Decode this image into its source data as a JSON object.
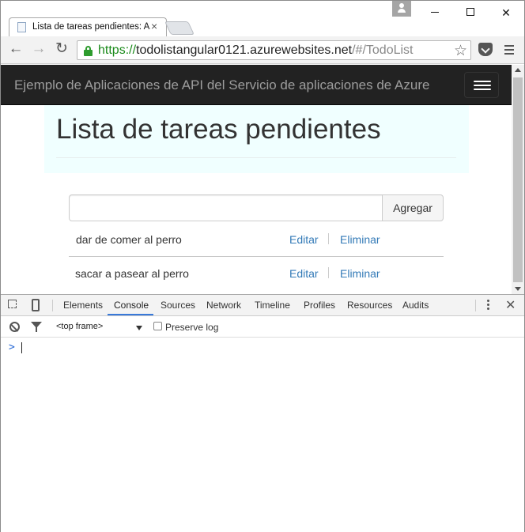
{
  "browser": {
    "tab_title": "Lista de tareas pendientes: A…",
    "url": {
      "scheme": "https://",
      "host": "todolistangular0121.azurewebsites.net",
      "path": "/#/TodoList"
    }
  },
  "page": {
    "brand": "Ejemplo de Aplicaciones de API del Servicio de aplicaciones de Azure",
    "title": "Lista de tareas pendientes",
    "new_task": {
      "value": "",
      "placeholder": ""
    },
    "add_label": "Agregar",
    "tasks": [
      {
        "text": "dar de comer al perro",
        "edit": "Editar",
        "delete": "Eliminar"
      },
      {
        "text": "sacar a pasear al perro",
        "edit": "Editar",
        "delete": "Eliminar"
      }
    ]
  },
  "devtools": {
    "tabs": [
      "Elements",
      "Console",
      "Sources",
      "Network",
      "Timeline",
      "Profiles",
      "Resources",
      "Audits"
    ],
    "active_tab": "Console",
    "frame": "<top frame>",
    "preserve_log": "Preserve log",
    "prompt": ">"
  },
  "colors": {
    "navbar": "#222222",
    "jumbotron": "#f0ffff",
    "link": "#337ab7",
    "secure": "#1a8a1a",
    "devtools_accent": "#3879d9"
  }
}
